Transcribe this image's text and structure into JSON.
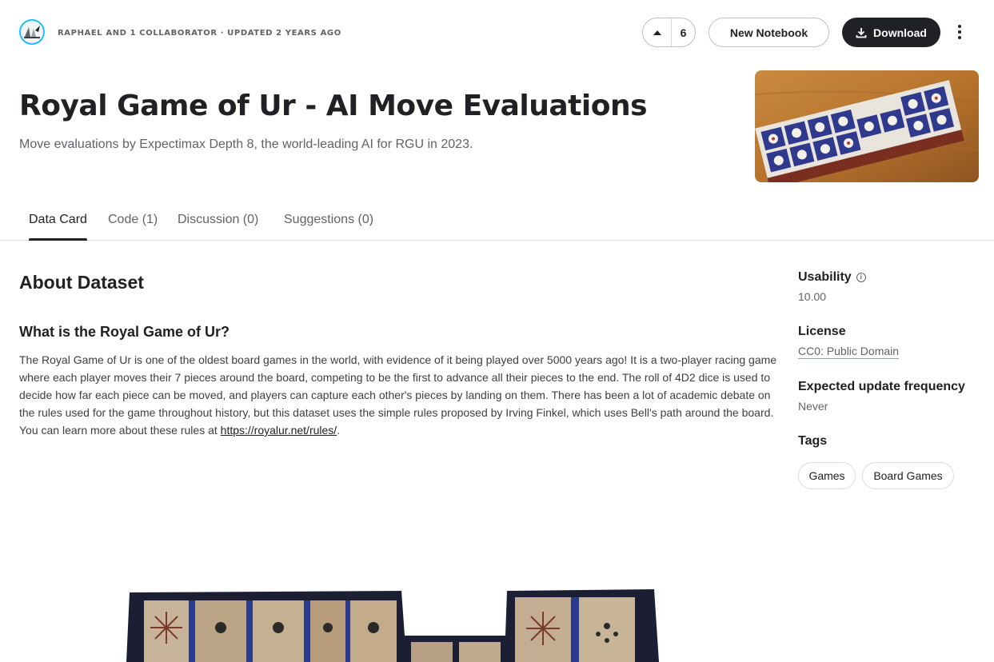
{
  "header": {
    "byline": "RAPHAEL AND 1 COLLABORATOR · UPDATED 2 YEARS AGO",
    "vote_count": "6",
    "new_notebook_label": "New Notebook",
    "download_label": "Download"
  },
  "dataset": {
    "title": "Royal Game of Ur - AI Move Evaluations",
    "subtitle": "Move evaluations by Expectimax Depth 8, the world-leading AI for RGU in 2023."
  },
  "tabs": [
    {
      "label": "Data Card",
      "active": true
    },
    {
      "label": "Code (1)",
      "active": false
    },
    {
      "label": "Discussion (0)",
      "active": false
    },
    {
      "label": "Suggestions (0)",
      "active": false
    }
  ],
  "about": {
    "heading": "About Dataset",
    "question": "What is the Royal Game of Ur?",
    "paragraph": "The Royal Game of Ur is one of the oldest board games in the world, with evidence of it being played over 5000 years ago! It is a two-player racing game where each player moves their 7 pieces around the board, competing to be the first to advance all their pieces to the end. The roll of 4D2 dice is used to decide how far each piece can be moved, and players can capture each other's pieces by landing on them. There has been a lot of academic debate on the rules used for the game throughout history, but this dataset uses the simple rules proposed by Irving Finkel, which uses Bell's path around the board. You can learn more about these rules at ",
    "link_text": "https://royalur.net/rules/",
    "trailing": "."
  },
  "sidebar": {
    "usability_label": "Usability",
    "usability_value": "10.00",
    "license_label": "License",
    "license_value": "CC0: Public Domain",
    "frequency_label": "Expected update frequency",
    "frequency_value": "Never",
    "tags_label": "Tags",
    "tags": [
      "Games",
      "Board Games"
    ]
  },
  "icons": {
    "upvote": "caret-up-icon",
    "download": "download-icon",
    "more": "more-vertical-icon",
    "info": "info-icon"
  },
  "colors": {
    "primary_dark": "#202124",
    "muted_text": "#5f6368",
    "border": "#dadce0"
  }
}
